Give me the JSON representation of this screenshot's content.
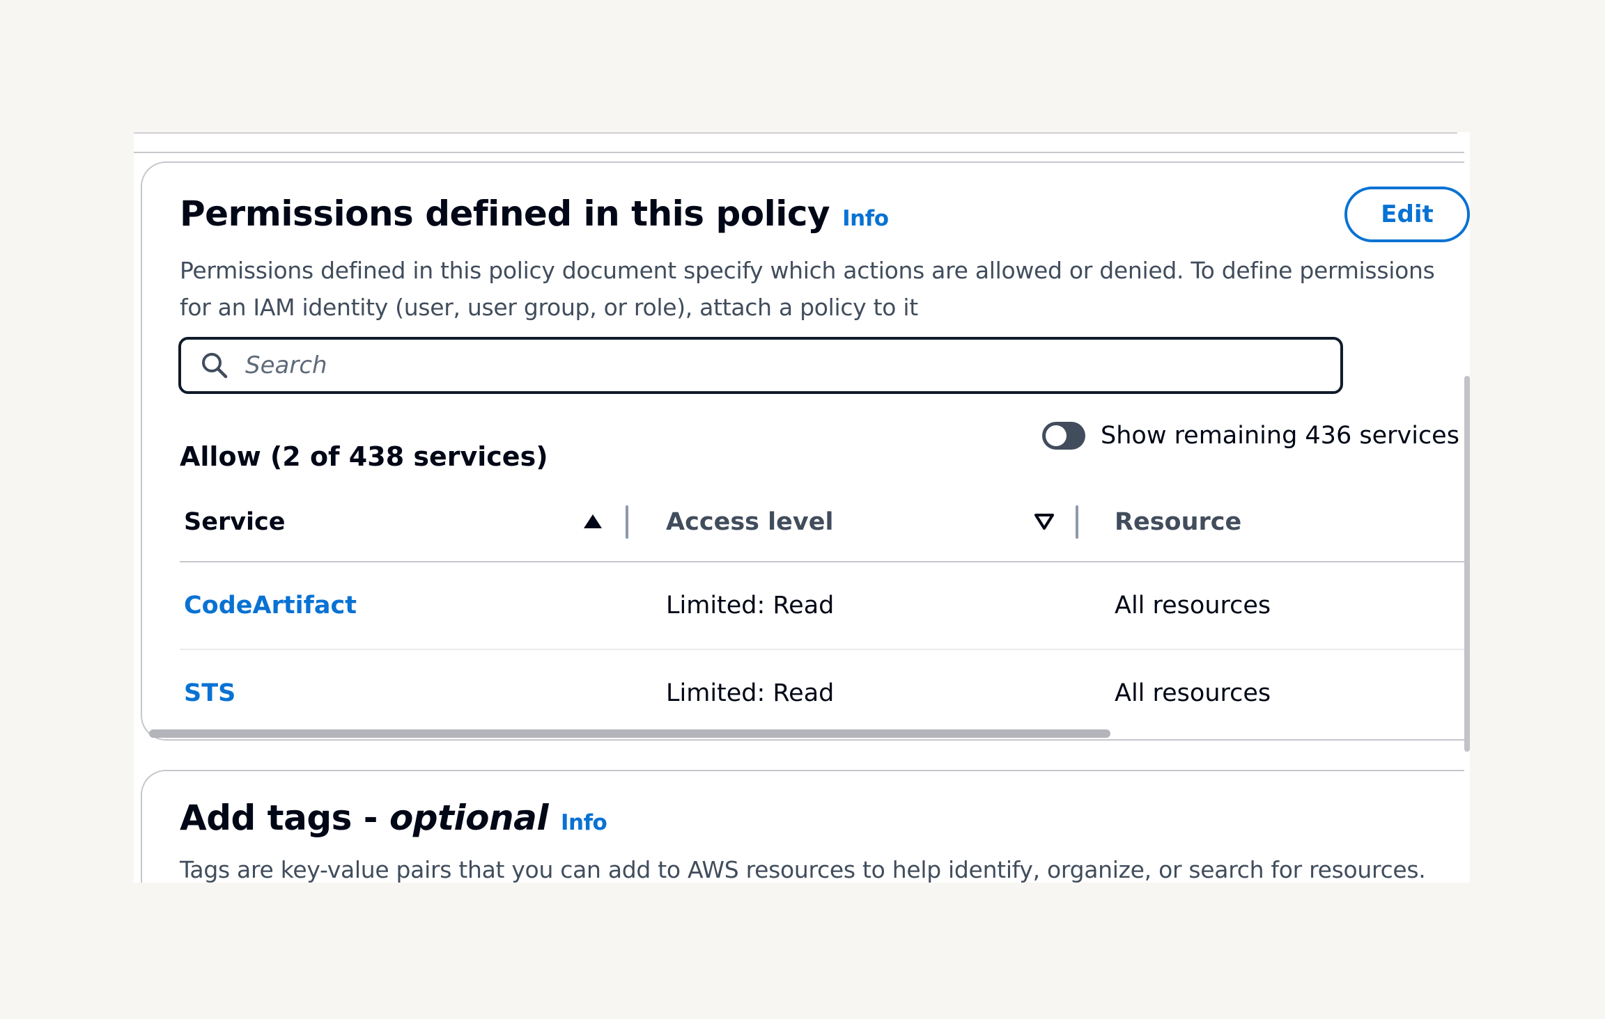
{
  "permissions_panel": {
    "title": "Permissions defined in this policy",
    "info_label": "Info",
    "edit_label": "Edit",
    "description": "Permissions defined in this policy document specify which actions are allowed or denied. To define permissions for an IAM identity (user, user group, or role), attach a policy to it",
    "search": {
      "placeholder": "Search",
      "value": ""
    },
    "allow_heading": "Allow (2 of 438 services)",
    "toggle": {
      "label": "Show remaining 436 services",
      "checked": false
    },
    "table": {
      "columns": [
        "Service",
        "Access level",
        "Resource"
      ],
      "rows": [
        {
          "service": "CodeArtifact",
          "access_level": "Limited: Read",
          "resource": "All resources"
        },
        {
          "service": "STS",
          "access_level": "Limited: Read",
          "resource": "All resources"
        }
      ]
    }
  },
  "tags_panel": {
    "title_main": "Add tags - ",
    "title_optional": "optional",
    "info_label": "Info",
    "description": "Tags are key-value pairs that you can add to AWS resources to help identify, organize, or search for resources."
  },
  "icons": {
    "search": "search-icon",
    "sort_ascending": "sort-ascending-icon",
    "sort_descending": "sort-descending-icon"
  },
  "colors": {
    "link": "#0972d3",
    "text": "#000716",
    "secondary_text": "#414d5c",
    "border": "#c6c6cd",
    "background": "#f8f6f2"
  }
}
